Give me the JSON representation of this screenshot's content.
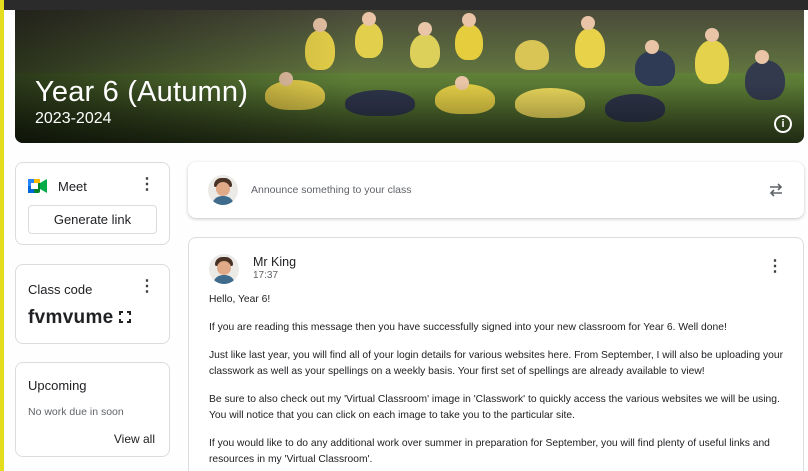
{
  "banner": {
    "title": "Year 6 (Autumn)",
    "subtitle": "2023-2024",
    "info_icon": "info-icon"
  },
  "meet": {
    "label": "Meet",
    "button": "Generate link",
    "icon": "meet-icon",
    "more_icon": "more-vert-icon"
  },
  "class_code": {
    "label": "Class code",
    "value": "fvmvume",
    "expand_icon": "fullscreen-icon"
  },
  "upcoming": {
    "title": "Upcoming",
    "empty_text": "No work due in soon",
    "link": "View all"
  },
  "announce": {
    "placeholder": "Announce something to your class",
    "repost_icon": "repost-icon"
  },
  "post": {
    "author": "Mr King",
    "time": "17:37",
    "paragraphs": [
      "Hello, Year 6!",
      "If you are reading this message then you have successfully signed into your new classroom for Year 6. Well done!",
      "Just like last year, you will find all of your login details for various websites here. From September, I will also be uploading your classwork as well as your spellings on a weekly basis. Your first set of spellings are already available to view!",
      "Be sure to also check out my 'Virtual Classroom' image in 'Classwork' to quickly access the various websites we will be using.  You will notice that you can click on each image to take you to the particular site.",
      "If you would like to do any additional work over summer in preparation for September, you will find plenty of useful links and resources in my 'Virtual Classroom'."
    ]
  },
  "colors": {
    "accent_yellow": "#e6dc1e",
    "border": "#dadce0",
    "muted_text": "#5f6368"
  }
}
